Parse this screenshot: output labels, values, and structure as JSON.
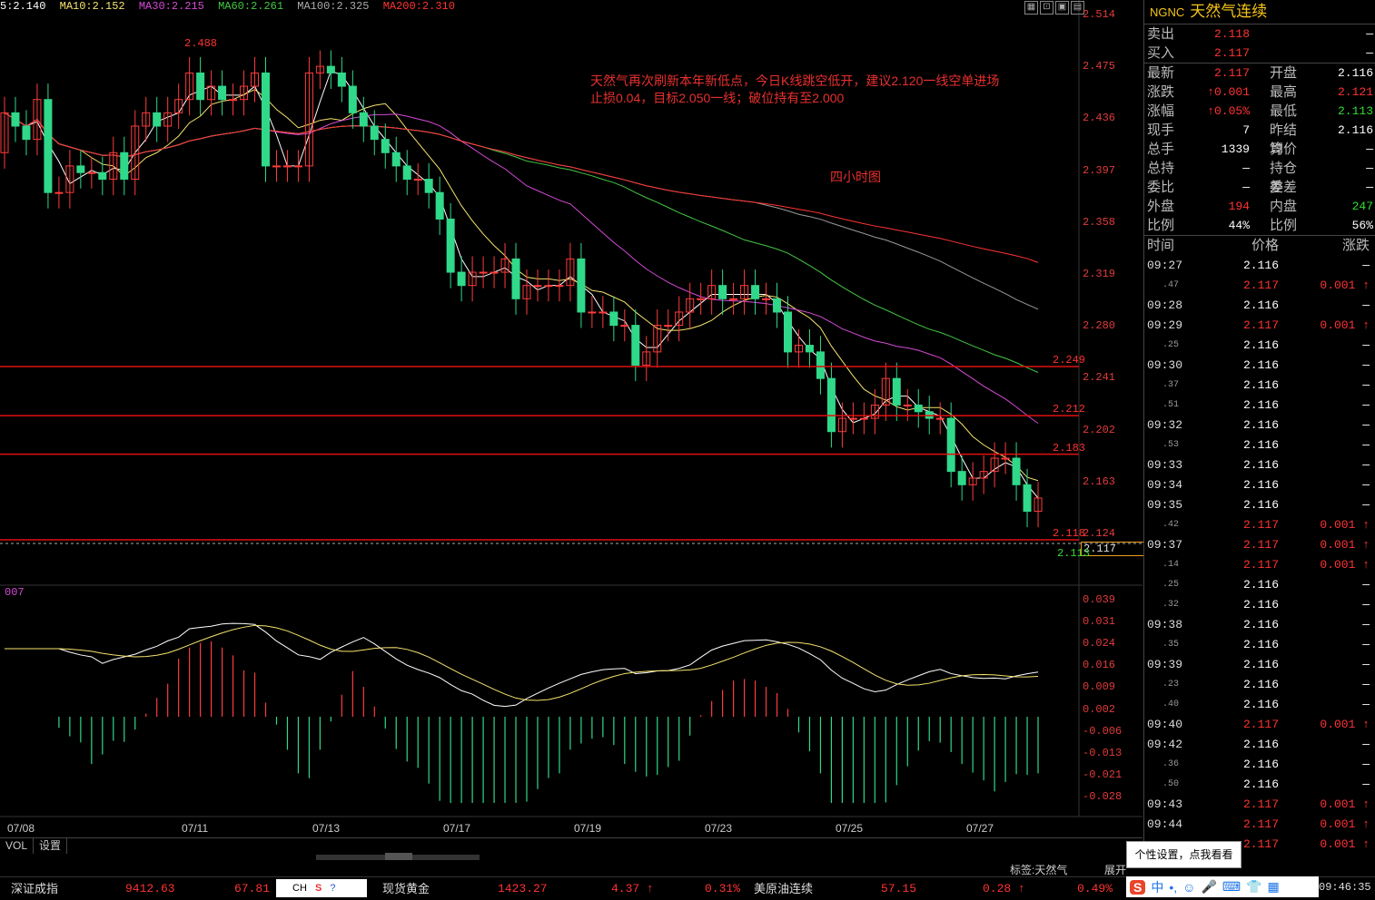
{
  "ma_bar": [
    {
      "label": "5:2.140",
      "color": "#ffffff"
    },
    {
      "label": "MA10:2.152",
      "color": "#f5e36b"
    },
    {
      "label": "MA30:2.215",
      "color": "#d64ad6"
    },
    {
      "label": "MA60:2.261",
      "color": "#43c743"
    },
    {
      "label": "MA100:2.325",
      "color": "#aaaaaa"
    },
    {
      "label": "MA200:2.310",
      "color": "#ff3333"
    }
  ],
  "y_axis": [
    "2.514",
    "2.475",
    "2.436",
    "2.397",
    "2.358",
    "2.319",
    "2.280",
    "2.241",
    "2.202",
    "2.163",
    "2.124"
  ],
  "macd_axis": [
    "0.039",
    "0.031",
    "0.024",
    "0.016",
    "0.009",
    "0.002",
    "-0.006",
    "-0.013",
    "-0.021",
    "-0.028"
  ],
  "x_axis": [
    "07/08",
    "07/11",
    "07/13",
    "07/17",
    "07/19",
    "07/23",
    "07/25",
    "07/27"
  ],
  "annotation": {
    "line1": "天然气再次刷新本年新低点，今日K线跳空低开，建议2.120一线空单进场",
    "line2": "止损0.04，目标2.050一线；破位持有至2.000",
    "period": "四小时图"
  },
  "high_label": "2.488",
  "support_lines": [
    {
      "label": "2.249"
    },
    {
      "label": "2.212"
    },
    {
      "label": "2.183"
    },
    {
      "label": "2.118"
    }
  ],
  "current_price_box": "2.117",
  "low_label": "2.113",
  "indicator_name": "007",
  "bottom_tabs": [
    "VOL",
    "设置"
  ],
  "tag_label": "标签:天然气",
  "expand_label": "展开",
  "tooltip": "个性设置，点我看看",
  "panel": {
    "code": "NGNC",
    "name": "天然气连续",
    "quote": [
      {
        "k": "卖出",
        "v": "2.118",
        "vc": "red",
        "k2": "",
        "v2": "—",
        "v2c": "white"
      },
      {
        "k": "买入",
        "v": "2.117",
        "vc": "red",
        "k2": "",
        "v2": "—",
        "v2c": "white"
      },
      {
        "k": "最新",
        "v": "2.117",
        "vc": "red",
        "k2": "开盘",
        "v2": "2.116",
        "v2c": "white"
      },
      {
        "k": "涨跌",
        "v": "↑0.001",
        "vc": "red",
        "k2": "最高",
        "v2": "2.121",
        "v2c": "red"
      },
      {
        "k": "涨幅",
        "v": "↑0.05%",
        "vc": "red",
        "k2": "最低",
        "v2": "2.113",
        "v2c": "green"
      },
      {
        "k": "现手",
        "v": "7",
        "vc": "white",
        "k2": "昨结算",
        "v2": "2.116",
        "v2c": "white"
      },
      {
        "k": "总手",
        "v": "1339",
        "vc": "white",
        "k2": "均价",
        "v2": "—",
        "v2c": "white"
      },
      {
        "k": "总持",
        "v": "—",
        "vc": "white",
        "k2": "持仓差",
        "v2": "—",
        "v2c": "white"
      },
      {
        "k": "委比",
        "v": "—",
        "vc": "white",
        "k2": "委差",
        "v2": "—",
        "v2c": "white"
      },
      {
        "k": "外盘",
        "v": "194",
        "vc": "red",
        "k2": "内盘",
        "v2": "247",
        "v2c": "green"
      },
      {
        "k": "比例",
        "v": "44%",
        "vc": "white",
        "k2": "比例",
        "v2": "56%",
        "v2c": "white"
      }
    ],
    "ticks_header": [
      "时间",
      "价格",
      "涨跌"
    ],
    "ticks": [
      {
        "t": "09:27",
        "sub": false,
        "p": "2.116",
        "pc": "white",
        "c": "—",
        "cc": "white"
      },
      {
        "t": ".47",
        "sub": true,
        "p": "2.117",
        "pc": "red",
        "c": "0.001 ↑",
        "cc": "red"
      },
      {
        "t": "09:28",
        "sub": false,
        "p": "2.116",
        "pc": "white",
        "c": "—",
        "cc": "white"
      },
      {
        "t": "09:29",
        "sub": false,
        "p": "2.117",
        "pc": "red",
        "c": "0.001 ↑",
        "cc": "red"
      },
      {
        "t": ".25",
        "sub": true,
        "p": "2.116",
        "pc": "white",
        "c": "—",
        "cc": "white"
      },
      {
        "t": "09:30",
        "sub": false,
        "p": "2.116",
        "pc": "white",
        "c": "—",
        "cc": "white"
      },
      {
        "t": ".37",
        "sub": true,
        "p": "2.116",
        "pc": "white",
        "c": "—",
        "cc": "white"
      },
      {
        "t": ".51",
        "sub": true,
        "p": "2.116",
        "pc": "white",
        "c": "—",
        "cc": "white"
      },
      {
        "t": "09:32",
        "sub": false,
        "p": "2.116",
        "pc": "white",
        "c": "—",
        "cc": "white"
      },
      {
        "t": ".53",
        "sub": true,
        "p": "2.116",
        "pc": "white",
        "c": "—",
        "cc": "white"
      },
      {
        "t": "09:33",
        "sub": false,
        "p": "2.116",
        "pc": "white",
        "c": "—",
        "cc": "white"
      },
      {
        "t": "09:34",
        "sub": false,
        "p": "2.116",
        "pc": "white",
        "c": "—",
        "cc": "white"
      },
      {
        "t": "09:35",
        "sub": false,
        "p": "2.116",
        "pc": "white",
        "c": "—",
        "cc": "white"
      },
      {
        "t": ".42",
        "sub": true,
        "p": "2.117",
        "pc": "red",
        "c": "0.001 ↑",
        "cc": "red"
      },
      {
        "t": "09:37",
        "sub": false,
        "p": "2.117",
        "pc": "red",
        "c": "0.001 ↑",
        "cc": "red"
      },
      {
        "t": ".14",
        "sub": true,
        "p": "2.117",
        "pc": "red",
        "c": "0.001 ↑",
        "cc": "red"
      },
      {
        "t": ".25",
        "sub": true,
        "p": "2.116",
        "pc": "white",
        "c": "—",
        "cc": "white"
      },
      {
        "t": ".32",
        "sub": true,
        "p": "2.116",
        "pc": "white",
        "c": "—",
        "cc": "white"
      },
      {
        "t": "09:38",
        "sub": false,
        "p": "2.116",
        "pc": "white",
        "c": "—",
        "cc": "white"
      },
      {
        "t": ".35",
        "sub": true,
        "p": "2.116",
        "pc": "white",
        "c": "—",
        "cc": "white"
      },
      {
        "t": "09:39",
        "sub": false,
        "p": "2.116",
        "pc": "white",
        "c": "—",
        "cc": "white"
      },
      {
        "t": ".23",
        "sub": true,
        "p": "2.116",
        "pc": "white",
        "c": "—",
        "cc": "white"
      },
      {
        "t": ".40",
        "sub": true,
        "p": "2.116",
        "pc": "white",
        "c": "—",
        "cc": "white"
      },
      {
        "t": "09:40",
        "sub": false,
        "p": "2.117",
        "pc": "red",
        "c": "0.001 ↑",
        "cc": "red"
      },
      {
        "t": "09:42",
        "sub": false,
        "p": "2.116",
        "pc": "white",
        "c": "—",
        "cc": "white"
      },
      {
        "t": ".36",
        "sub": true,
        "p": "2.116",
        "pc": "white",
        "c": "—",
        "cc": "white"
      },
      {
        "t": ".50",
        "sub": true,
        "p": "2.116",
        "pc": "white",
        "c": "—",
        "cc": "white"
      },
      {
        "t": "09:43",
        "sub": false,
        "p": "2.117",
        "pc": "red",
        "c": "0.001 ↑",
        "cc": "red"
      },
      {
        "t": "09:44",
        "sub": false,
        "p": "2.117",
        "pc": "red",
        "c": "0.001 ↑",
        "cc": "red"
      },
      {
        "t": "",
        "sub": false,
        "p": "2.117",
        "pc": "red",
        "c": "0.001 ↑",
        "cc": "red"
      }
    ]
  },
  "status": {
    "idx1_name": "深证成指",
    "idx1_value": "9412.63",
    "idx1_change": "67.81 ↑",
    "idx2_name": "现货黄金",
    "idx2_value": "1423.27",
    "idx2_change": "4.37 ↑",
    "idx2_pct": "0.31%",
    "idx3_name": "美原油连续",
    "idx3_value": "57.15",
    "idx3_change": "0.28 ↑",
    "idx3_pct": "0.49%",
    "ch": "CH",
    "clock": "09:46:35"
  },
  "ime": {
    "label": "中"
  }
}
